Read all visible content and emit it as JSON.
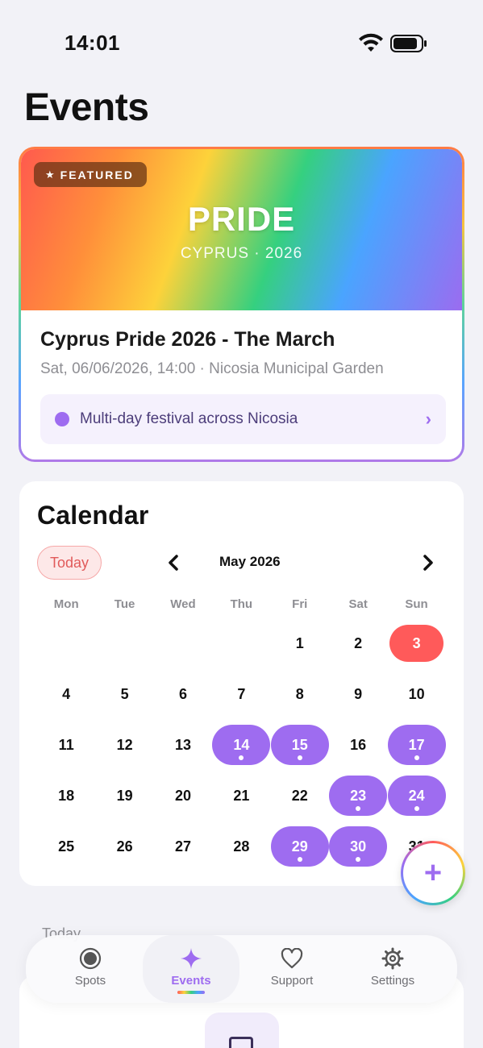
{
  "status_bar": {
    "time": "14:01"
  },
  "page": {
    "title": "Events"
  },
  "featured": {
    "badge": "FEATURED",
    "banner_title": "PRIDE",
    "banner_subtitle": "CYPRUS · 2026",
    "event_title": "Cyprus Pride 2026 - The March",
    "event_meta": "Sat, 06/06/2026, 14:00 · Nicosia Municipal Garden",
    "festival_text": "Multi-day festival across Nicosia"
  },
  "calendar": {
    "title": "Calendar",
    "today_label": "Today",
    "month_label": "May 2026",
    "weekdays": [
      "Mon",
      "Tue",
      "Wed",
      "Thu",
      "Fri",
      "Sat",
      "Sun"
    ],
    "days": [
      {
        "d": "1",
        "type": ""
      },
      {
        "d": "2",
        "type": ""
      },
      {
        "d": "3",
        "type": "today"
      },
      {
        "d": "4",
        "type": ""
      },
      {
        "d": "5",
        "type": ""
      },
      {
        "d": "6",
        "type": ""
      },
      {
        "d": "7",
        "type": ""
      },
      {
        "d": "8",
        "type": ""
      },
      {
        "d": "9",
        "type": ""
      },
      {
        "d": "10",
        "type": ""
      },
      {
        "d": "11",
        "type": ""
      },
      {
        "d": "12",
        "type": ""
      },
      {
        "d": "13",
        "type": ""
      },
      {
        "d": "14",
        "type": "event"
      },
      {
        "d": "15",
        "type": "event"
      },
      {
        "d": "16",
        "type": ""
      },
      {
        "d": "17",
        "type": "event"
      },
      {
        "d": "18",
        "type": ""
      },
      {
        "d": "19",
        "type": ""
      },
      {
        "d": "20",
        "type": ""
      },
      {
        "d": "21",
        "type": ""
      },
      {
        "d": "22",
        "type": ""
      },
      {
        "d": "23",
        "type": "event"
      },
      {
        "d": "24",
        "type": "event"
      },
      {
        "d": "25",
        "type": ""
      },
      {
        "d": "26",
        "type": ""
      },
      {
        "d": "27",
        "type": ""
      },
      {
        "d": "28",
        "type": ""
      },
      {
        "d": "29",
        "type": "event"
      },
      {
        "d": "30",
        "type": "event"
      },
      {
        "d": "31",
        "type": ""
      }
    ],
    "first_weekday_index": 4
  },
  "fab": {
    "icon": "plus-icon",
    "label": "+"
  },
  "section": {
    "label": "Today"
  },
  "tabs": [
    {
      "label": "Spots",
      "icon": "spot-icon",
      "active": false
    },
    {
      "label": "Events",
      "icon": "sparkle-icon",
      "active": true
    },
    {
      "label": "Support",
      "icon": "heart-icon",
      "active": false
    },
    {
      "label": "Settings",
      "icon": "gear-icon",
      "active": false
    }
  ],
  "colors": {
    "accent": "#9e6cf0",
    "today": "#ff5a5a",
    "background": "#f2f2f7"
  }
}
